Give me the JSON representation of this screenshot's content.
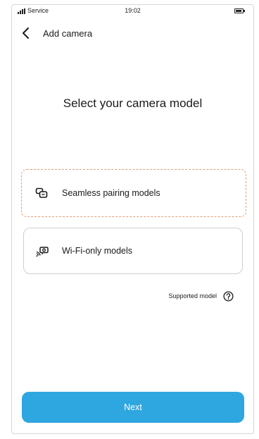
{
  "status_bar": {
    "carrier": "Service",
    "time": "19:02"
  },
  "header": {
    "title": "Add camera",
    "back_icon": "chevron-left-icon"
  },
  "main": {
    "title": "Select your camera model",
    "options": [
      {
        "label": "Seamless pairing models",
        "icon": "pairing-icon",
        "selected": true
      },
      {
        "label": "Wi-Fi-only models",
        "icon": "wifi-camera-icon",
        "selected": false
      }
    ],
    "supported_link": {
      "label": "Supported model",
      "icon": "help-circle-icon"
    }
  },
  "footer": {
    "next_label": "Next"
  },
  "colors": {
    "primary": "#2ea6e0",
    "selection_dash": "#e0a07a",
    "card_border": "#cfcfcf",
    "text": "#1a1a1a"
  }
}
